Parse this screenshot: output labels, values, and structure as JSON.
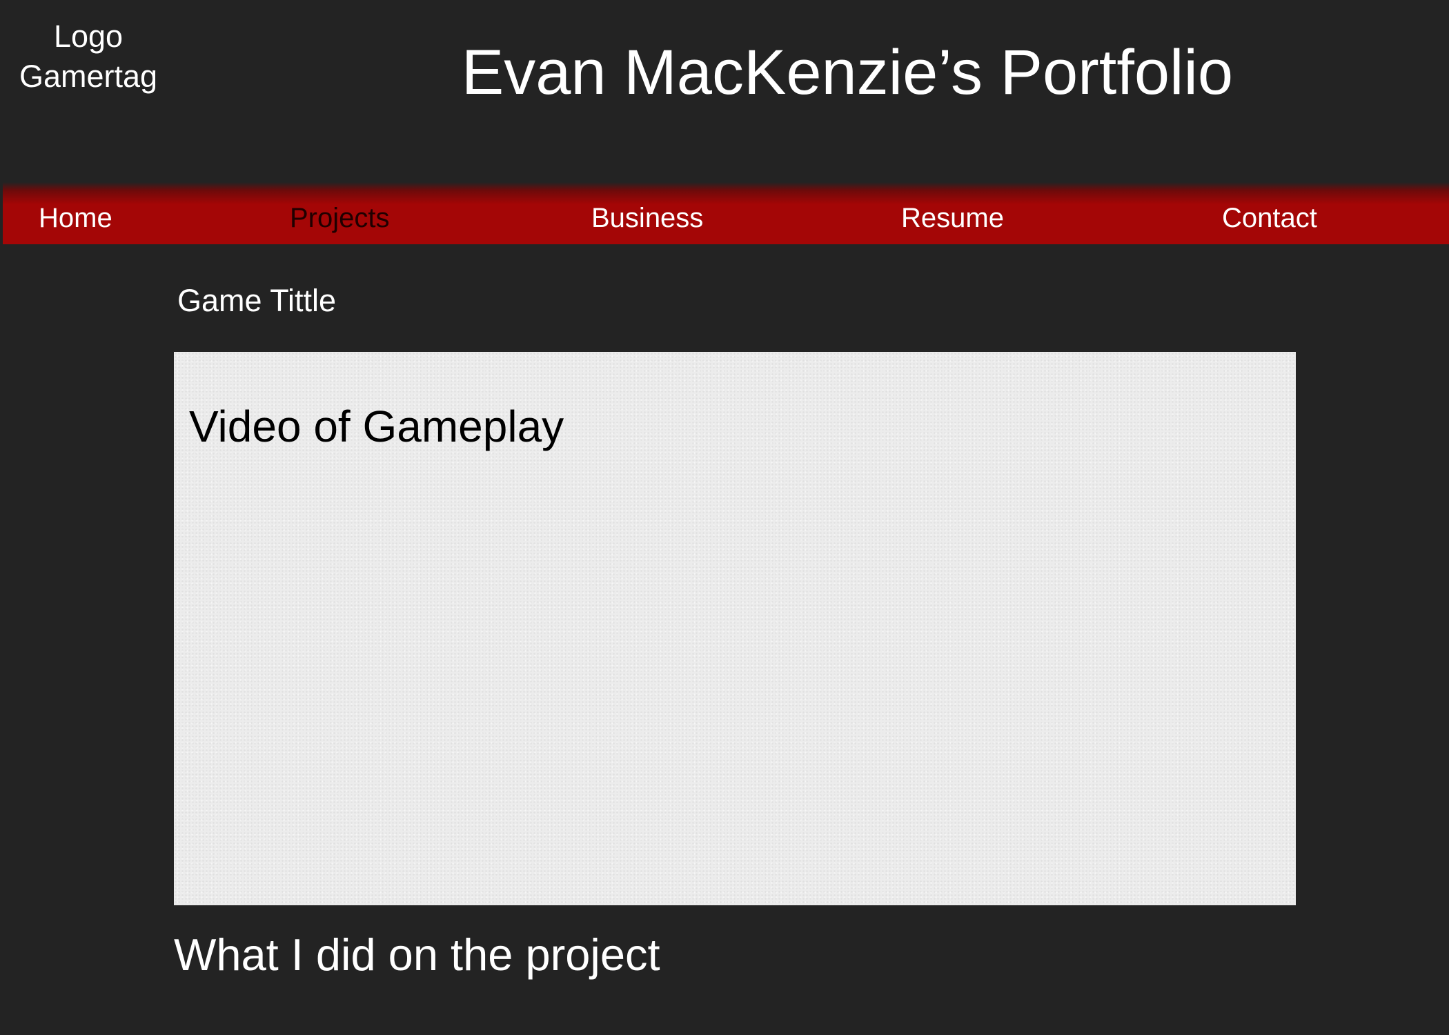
{
  "header": {
    "logo_line1": "Logo",
    "logo_line2": "Gamertag",
    "title": "Evan MacKenzie’s Portfolio"
  },
  "nav": {
    "items": [
      {
        "label": "Home",
        "active": false
      },
      {
        "label": "Projects",
        "active": true
      },
      {
        "label": "Business",
        "active": false
      },
      {
        "label": "Resume",
        "active": false
      },
      {
        "label": "Contact",
        "active": false
      }
    ]
  },
  "main": {
    "game_title": "Game Tittle",
    "video_label": "Video of Gameplay",
    "description_heading": "What I did on the project"
  },
  "colors": {
    "background": "#232323",
    "nav_bar": "#a40606",
    "video_placeholder": "#ececec",
    "text": "#ffffff"
  }
}
